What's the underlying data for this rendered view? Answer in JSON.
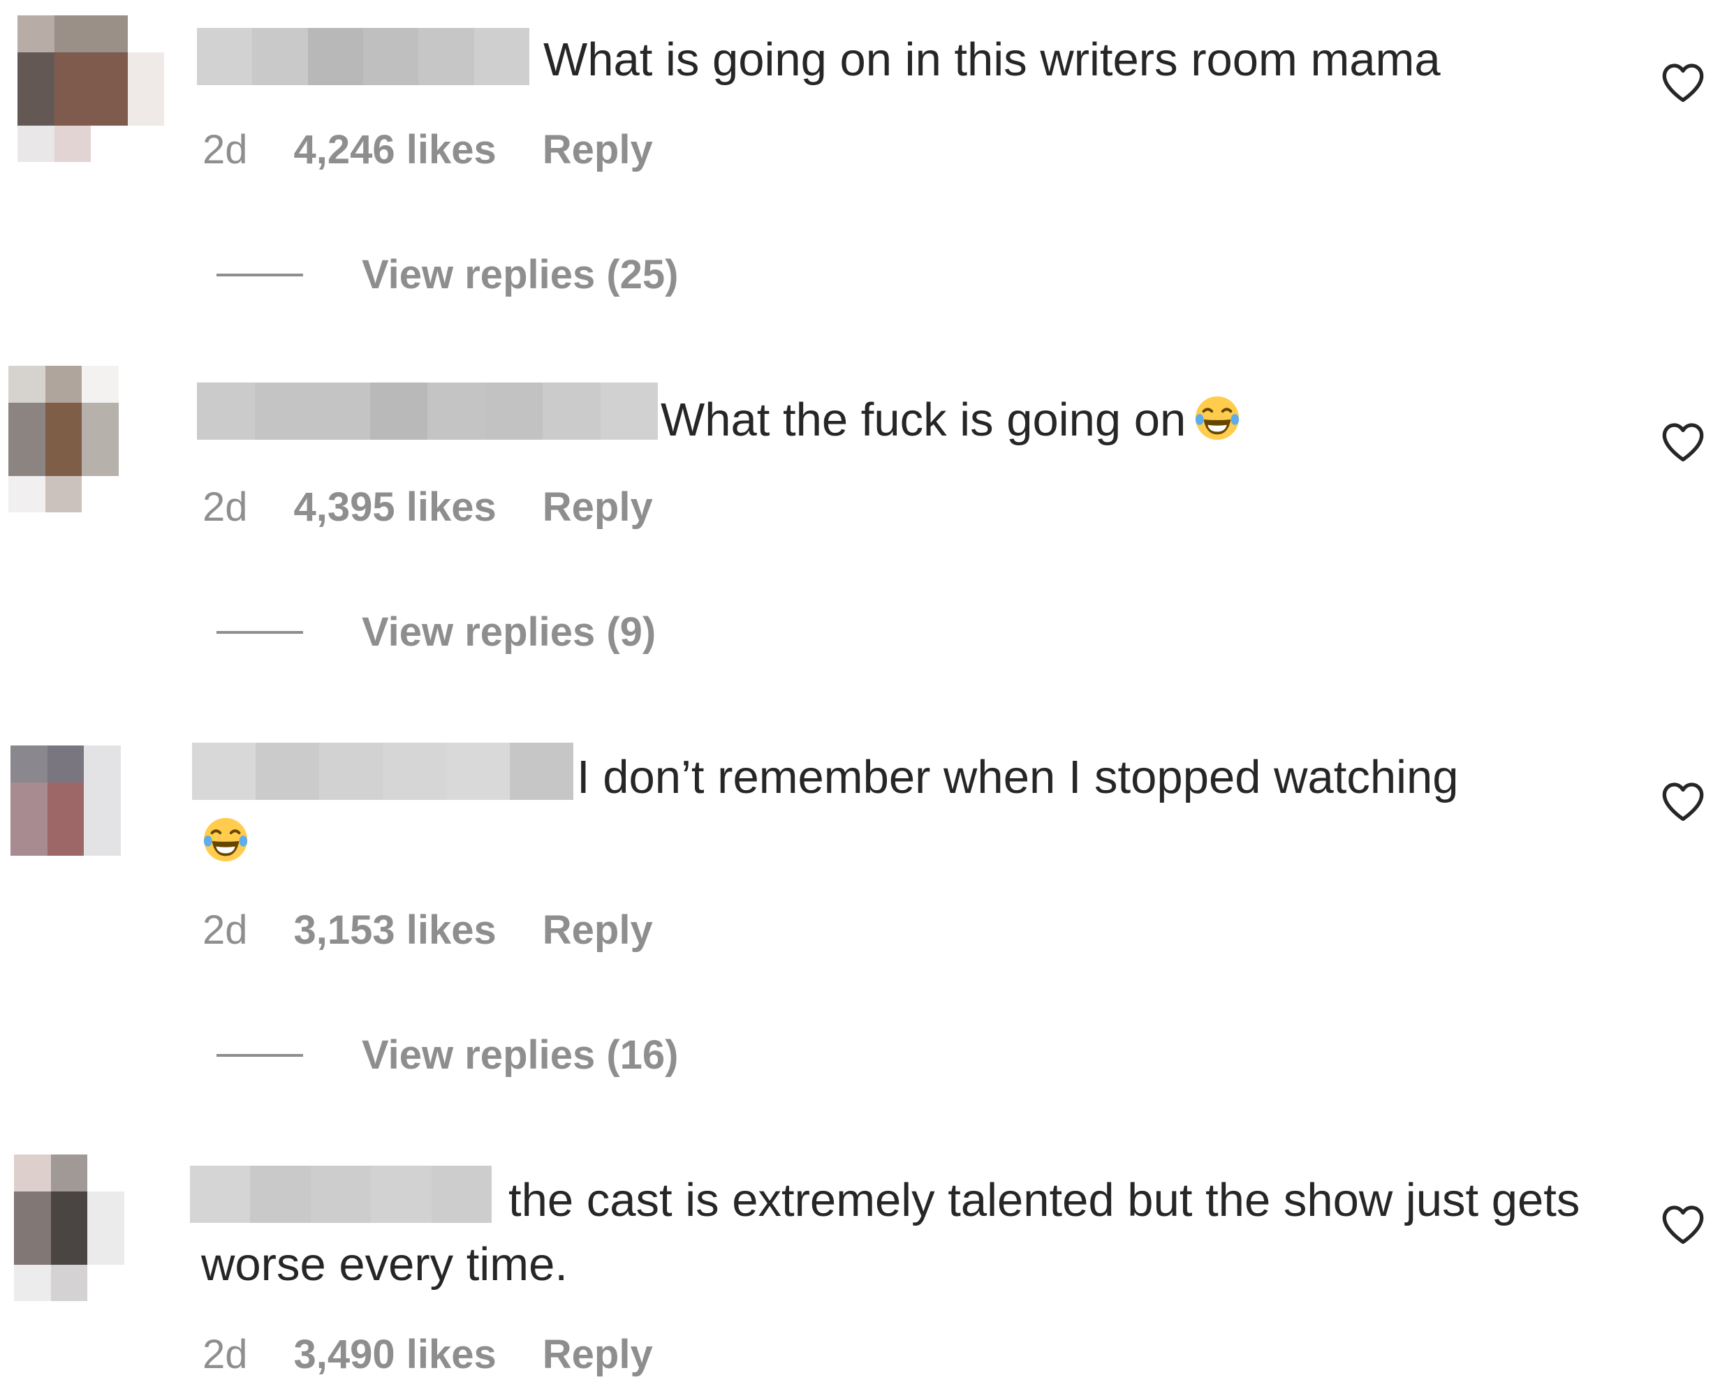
{
  "comments": [
    {
      "text": "What is going on in this writers room mama",
      "time": "2d",
      "likes": "4,246 likes",
      "reply_label": "Reply",
      "view_replies": "View replies (25)",
      "has_emoji": false,
      "avatar_colors": [
        "#b8aca7",
        "#9b9088",
        "#9b9088",
        "#ffffff",
        "#645855",
        "#7e5b4d",
        "#7e5b4d",
        "#efe9e7",
        "#645855",
        "#7e5b4d",
        "#7e5b4d",
        "#efe9e7",
        "#e9e7e7",
        "#e1d4d2",
        "#ffffff",
        "#ffffff"
      ],
      "username_colors": [
        "#d2d2d2",
        "#c9c9c9",
        "#b8b8b8",
        "#bfbfbf",
        "#c6c6c6",
        "#cfcfcf"
      ]
    },
    {
      "text": "What the fuck is going on",
      "time": "2d",
      "likes": "4,395 likes",
      "reply_label": "Reply",
      "view_replies": "View replies (9)",
      "has_emoji": true,
      "avatar_colors": [
        "#d6d2cd",
        "#afa59d",
        "#f4f2f1",
        "#ffffff",
        "#8c8480",
        "#7e5e47",
        "#b6b1ab",
        "#ffffff",
        "#8c8480",
        "#7e5e47",
        "#b6b1ab",
        "#ffffff",
        "#f1efef",
        "#cbc2be",
        "#ffffff",
        "#ffffff"
      ],
      "username_colors": [
        "#cbcbcb",
        "#c4c4c4",
        "#c4c4c4",
        "#b9b9b9",
        "#c4c4c4",
        "#c2c2c2",
        "#cbcbcb",
        "#d1d1d1"
      ]
    },
    {
      "text": "I don’t remember when I stopped watching",
      "time": "2d",
      "likes": "3,153 likes",
      "reply_label": "Reply",
      "view_replies": "View replies (16)",
      "has_emoji": true,
      "avatar_colors": [
        "#8a878e",
        "#7a7680",
        "#e3e3e5",
        "#ffffff",
        "#a78b90",
        "#9d6767",
        "#e3e3e5",
        "#ffffff",
        "#a78b90",
        "#9d6767",
        "#e3e3e5",
        "#ffffff",
        "#ffffff",
        "#ffffff",
        "#ffffff",
        "#ffffff"
      ],
      "username_colors": [
        "#d8d8d8",
        "#cbcbcb",
        "#d2d2d2",
        "#d6d6d6",
        "#d9d9d9",
        "#c6c6c6"
      ]
    },
    {
      "text": "the cast is extremely talented but the show just gets worse every time.",
      "time": "2d",
      "likes": "3,490 likes",
      "reply_label": "Reply",
      "view_replies": "",
      "has_emoji": false,
      "avatar_colors": [
        "#ddd0cc",
        "#a09995",
        "#ffffff",
        "#ffffff",
        "#817774",
        "#4a4442",
        "#ebebeb",
        "#ffffff",
        "#817774",
        "#4a4442",
        "#ebebeb",
        "#ffffff",
        "#ececec",
        "#d4d2d2",
        "#ffffff",
        "#ffffff"
      ],
      "username_colors": [
        "#d5d5d5",
        "#c9c9c9",
        "#cdcdcd",
        "#d2d2d2",
        "#cdcdcd"
      ]
    }
  ]
}
